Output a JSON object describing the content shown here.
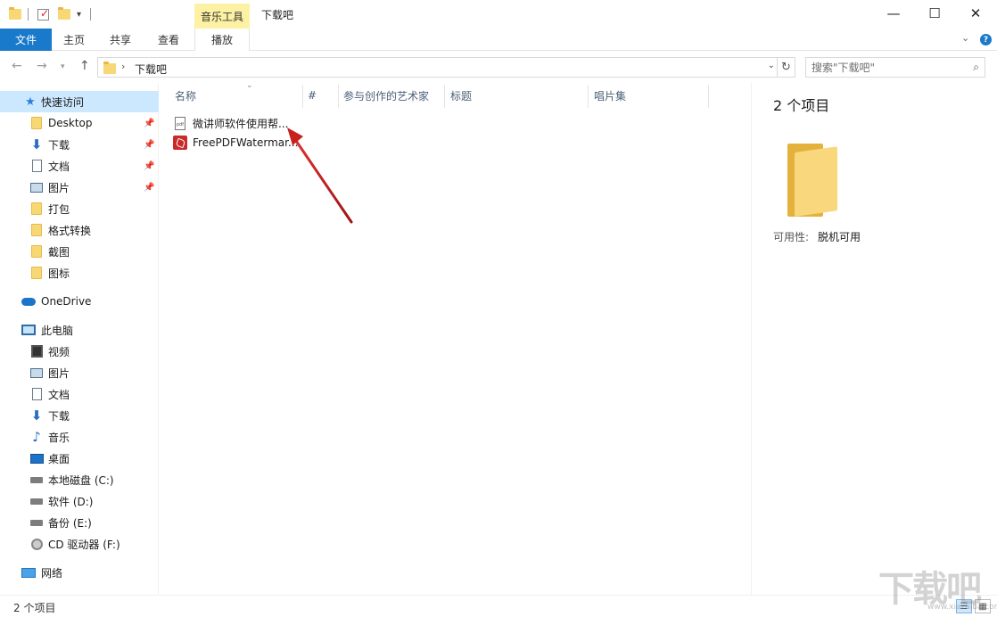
{
  "titlebar": {
    "window_title": "下载吧",
    "context_group": "音乐工具",
    "minimize": "—",
    "maximize": "☐",
    "close": "✕"
  },
  "ribbon": {
    "file_tab": "文件",
    "tabs": [
      "主页",
      "共享",
      "查看"
    ],
    "play_tab": "播放",
    "expand": "⌄",
    "help": "?"
  },
  "address": {
    "breadcrumb": "下载吧",
    "search_placeholder": "搜索\"下载吧\""
  },
  "sidebar": {
    "quick_access": "快速访问",
    "quick_items": [
      {
        "label": "Desktop",
        "icon": "folder-icon",
        "pinned": true
      },
      {
        "label": "下载",
        "icon": "download-icon",
        "pinned": true
      },
      {
        "label": "文档",
        "icon": "document-icon",
        "pinned": true
      },
      {
        "label": "图片",
        "icon": "picture-icon",
        "pinned": true
      },
      {
        "label": "打包",
        "icon": "folder-icon",
        "pinned": false
      },
      {
        "label": "格式转换",
        "icon": "folder-icon",
        "pinned": false
      },
      {
        "label": "截图",
        "icon": "folder-icon",
        "pinned": false
      },
      {
        "label": "图标",
        "icon": "folder-icon",
        "pinned": false
      }
    ],
    "onedrive": "OneDrive",
    "this_pc": "此电脑",
    "pc_items": [
      {
        "label": "视频",
        "icon": "video-icon"
      },
      {
        "label": "图片",
        "icon": "picture-icon"
      },
      {
        "label": "文档",
        "icon": "document-icon"
      },
      {
        "label": "下载",
        "icon": "download-icon"
      },
      {
        "label": "音乐",
        "icon": "music-icon"
      },
      {
        "label": "桌面",
        "icon": "desktop-icon"
      },
      {
        "label": "本地磁盘 (C:)",
        "icon": "drive-icon"
      },
      {
        "label": "软件 (D:)",
        "icon": "drive-icon"
      },
      {
        "label": "备份 (E:)",
        "icon": "drive-icon"
      },
      {
        "label": "CD 驱动器 (F:)",
        "icon": "cd-drive-icon"
      }
    ],
    "network": "网络"
  },
  "columns": [
    "名称",
    "#",
    "参与创作的艺术家",
    "标题",
    "唱片集"
  ],
  "files": [
    {
      "name": "微讲师软件使用帮...",
      "icon": "pdf-document-icon"
    },
    {
      "name": "FreePDFWatermar...",
      "icon": "pdf-app-icon"
    }
  ],
  "details": {
    "count": "2 个项目",
    "availability_label": "可用性:",
    "availability_value": "脱机可用"
  },
  "status": {
    "count": "2 个项目"
  },
  "watermark": {
    "text": "下载吧",
    "sub": "www.xiazaiba.com"
  }
}
